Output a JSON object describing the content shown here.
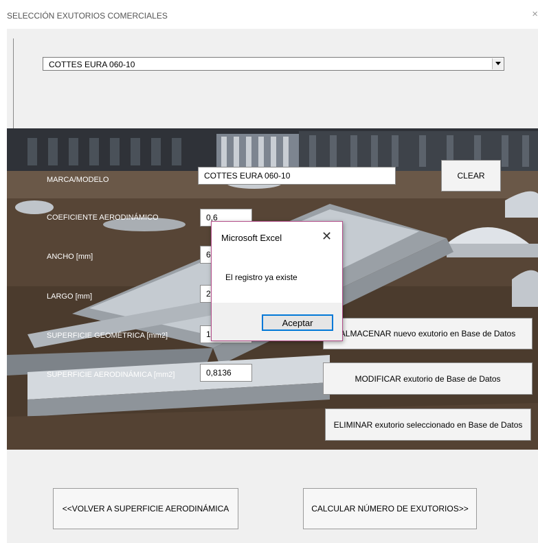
{
  "window": {
    "title": "SELECCIÓN EXUTORIOS COMERCIALES",
    "close_glyph": "×"
  },
  "selector": {
    "value": "COTTES EURA 060-10"
  },
  "fields": {
    "marca_label": "MARCA/MODELO",
    "marca_value": "COTTES EURA 060-10",
    "coef_label": "COEFICIENTE AERODINÁMICO",
    "coef_value": "0,6",
    "ancho_label": "ANCHO [mm]",
    "ancho_value": "600",
    "largo_label": "LARGO [mm]",
    "largo_value": "2260",
    "sup_geo_label": "SUPERFICIE GEOMÉTRICA [mm2]",
    "sup_geo_value": "1,356",
    "sup_aero_label": "SUPERFICIE AERODINÁMICA [mm2]",
    "sup_aero_value": "0,8136"
  },
  "buttons": {
    "clear": "CLEAR",
    "store": "ALMACENAR nuevo exutorio en Base de Datos",
    "modify": "MODIFICAR exutorio de Base de Datos",
    "delete": "ELIMINAR exutorio seleccionado en Base de Datos",
    "back": "<<VOLVER A SUPERFICIE AERODINÁMICA",
    "calc": "CALCULAR NÚMERO DE EXUTORIOS>>"
  },
  "dialog": {
    "title": "Microsoft Excel",
    "close_glyph": "✕",
    "message": "El registro ya existe",
    "ok_label": "Aceptar"
  },
  "colors": {
    "form_background": "#f0f0f0",
    "dialog_border": "#b24b88",
    "default_button_border": "#0078d7"
  },
  "icons": {
    "combo_dropdown": "triangle-down-icon",
    "window_close": "close-icon",
    "dialog_close": "close-icon"
  }
}
